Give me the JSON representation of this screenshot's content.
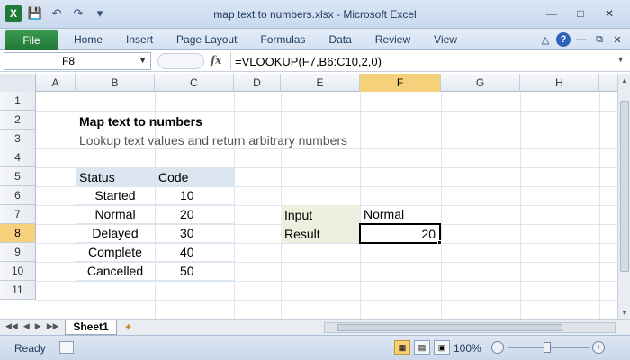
{
  "window": {
    "title": "map text to numbers.xlsx - Microsoft Excel",
    "min_icon": "minimize-icon",
    "max_icon": "maximize-icon",
    "close_icon": "close-icon"
  },
  "qat": [
    "excel-logo-icon",
    "save-icon",
    "undo-icon",
    "redo-icon",
    "customize-qat-icon"
  ],
  "ribbon": {
    "file_tab": "File",
    "tabs": [
      "Home",
      "Insert",
      "Page Layout",
      "Formulas",
      "Data",
      "Review",
      "View"
    ]
  },
  "formula_bar": {
    "name_box": "F8",
    "fx": "fx",
    "formula": "=VLOOKUP(F7,B6:C10,2,0)"
  },
  "grid": {
    "columns": [
      "A",
      "B",
      "C",
      "D",
      "E",
      "F",
      "G",
      "H"
    ],
    "rows": [
      "1",
      "2",
      "3",
      "4",
      "5",
      "6",
      "7",
      "8",
      "9",
      "10",
      "11"
    ],
    "selected_column": "F",
    "selected_row": "8"
  },
  "sheet": {
    "heading": "Map text to numbers",
    "subheading": "Lookup text values and return arbitrary numbers",
    "table": {
      "headers": [
        "Status",
        "Code"
      ],
      "rows": [
        [
          "Started",
          "10"
        ],
        [
          "Normal",
          "20"
        ],
        [
          "Delayed",
          "30"
        ],
        [
          "Complete",
          "40"
        ],
        [
          "Cancelled",
          "50"
        ]
      ]
    },
    "input_label": "Input",
    "input_value": "Normal",
    "result_label": "Result",
    "result_value": "20"
  },
  "tabs_bar": {
    "sheet_name": "Sheet1"
  },
  "status_bar": {
    "status": "Ready",
    "zoom": "100%",
    "zoom_level": 100
  }
}
